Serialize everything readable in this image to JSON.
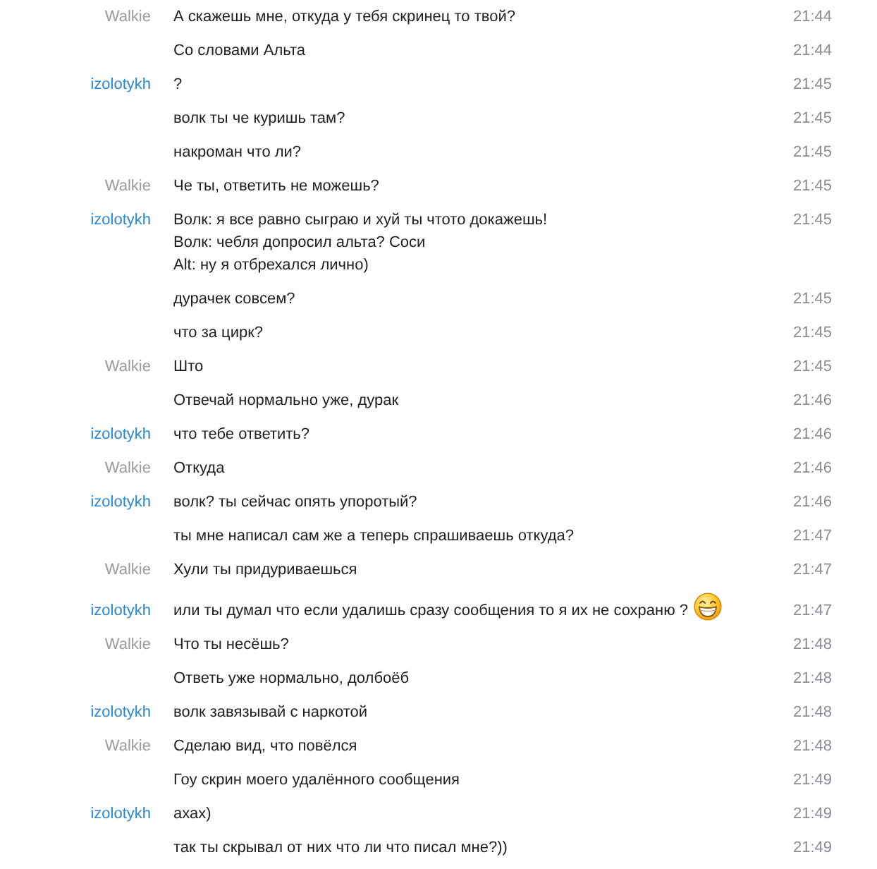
{
  "messages": [
    {
      "sender": "Walkie",
      "color": "#9b9b9b",
      "text": "А скажешь мне, откуда у тебя скринец то твой?",
      "time": "21:44"
    },
    {
      "text": "Со словами Альта",
      "time": "21:44"
    },
    {
      "sender": "izolotykh",
      "color": "#2a88d2",
      "text": "?",
      "time": "21:45"
    },
    {
      "text": "волк ты че куришь там?",
      "time": "21:45"
    },
    {
      "text": "накроман что ли?",
      "time": "21:45"
    },
    {
      "sender": "Walkie",
      "color": "#9b9b9b",
      "text": "Че ты, ответить не можешь?",
      "time": "21:45"
    },
    {
      "sender": "izolotykh",
      "color": "#2a88d2",
      "text": "Волк: я все равно сыграю и хуй ты чтото докажешь!\nВолк: чебля допросил альта? Соси\nAlt: ну я отбрехался лично)",
      "time": "21:45"
    },
    {
      "text": "дурачек совсем?",
      "time": "21:45"
    },
    {
      "text": "что за цирк?",
      "time": "21:45"
    },
    {
      "sender": "Walkie",
      "color": "#9b9b9b",
      "text": "Што",
      "time": "21:45"
    },
    {
      "text": "Отвечай нормально уже, дурак",
      "time": "21:46"
    },
    {
      "sender": "izolotykh",
      "color": "#2a88d2",
      "text": "что тебе ответить?",
      "time": "21:46"
    },
    {
      "sender": "Walkie",
      "color": "#9b9b9b",
      "text": "Откуда",
      "time": "21:46"
    },
    {
      "sender": "izolotykh",
      "color": "#2a88d2",
      "text": "волк? ты сейчас опять упоротый?",
      "time": "21:46"
    },
    {
      "text": "ты мне написал сам же а теперь спрашиваешь откуда?",
      "time": "21:47"
    },
    {
      "sender": "Walkie",
      "color": "#9b9b9b",
      "text": "Хули ты придуриваешься",
      "time": "21:47"
    },
    {
      "sender": "izolotykh",
      "color": "#2a88d2",
      "text": "или ты думал что если удалишь сразу сообщения то я их не сохраню ?",
      "emoticon": true,
      "time": "21:47"
    },
    {
      "sender": "Walkie",
      "color": "#9b9b9b",
      "text": "Что ты несёшь?",
      "time": "21:48"
    },
    {
      "text": "Ответь уже нормально, долбоёб",
      "time": "21:48"
    },
    {
      "sender": "izolotykh",
      "color": "#2a88d2",
      "text": "волк завязывай с наркотой",
      "time": "21:48"
    },
    {
      "sender": "Walkie",
      "color": "#9b9b9b",
      "text": "Сделаю вид, что повёлся",
      "time": "21:48"
    },
    {
      "text": "Гоу скрин моего удалённого сообщения",
      "time": "21:49"
    },
    {
      "sender": "izolotykh",
      "color": "#2a88d2",
      "text": "ахах)",
      "time": "21:49"
    },
    {
      "text": "так ты скрывал от них что ли что писал мне?))",
      "time": "21:49"
    }
  ]
}
